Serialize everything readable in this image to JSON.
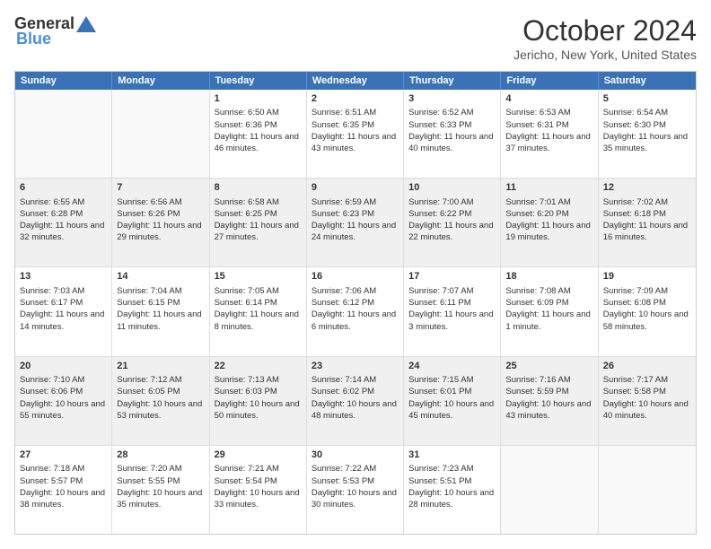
{
  "header": {
    "logo_general": "General",
    "logo_blue": "Blue",
    "month_title": "October 2024",
    "location": "Jericho, New York, United States"
  },
  "weekdays": [
    "Sunday",
    "Monday",
    "Tuesday",
    "Wednesday",
    "Thursday",
    "Friday",
    "Saturday"
  ],
  "rows": [
    [
      {
        "day": "",
        "sunrise": "",
        "sunset": "",
        "daylight": "",
        "empty": true
      },
      {
        "day": "",
        "sunrise": "",
        "sunset": "",
        "daylight": "",
        "empty": true
      },
      {
        "day": "1",
        "sunrise": "Sunrise: 6:50 AM",
        "sunset": "Sunset: 6:36 PM",
        "daylight": "Daylight: 11 hours and 46 minutes."
      },
      {
        "day": "2",
        "sunrise": "Sunrise: 6:51 AM",
        "sunset": "Sunset: 6:35 PM",
        "daylight": "Daylight: 11 hours and 43 minutes."
      },
      {
        "day": "3",
        "sunrise": "Sunrise: 6:52 AM",
        "sunset": "Sunset: 6:33 PM",
        "daylight": "Daylight: 11 hours and 40 minutes."
      },
      {
        "day": "4",
        "sunrise": "Sunrise: 6:53 AM",
        "sunset": "Sunset: 6:31 PM",
        "daylight": "Daylight: 11 hours and 37 minutes."
      },
      {
        "day": "5",
        "sunrise": "Sunrise: 6:54 AM",
        "sunset": "Sunset: 6:30 PM",
        "daylight": "Daylight: 11 hours and 35 minutes."
      }
    ],
    [
      {
        "day": "6",
        "sunrise": "Sunrise: 6:55 AM",
        "sunset": "Sunset: 6:28 PM",
        "daylight": "Daylight: 11 hours and 32 minutes."
      },
      {
        "day": "7",
        "sunrise": "Sunrise: 6:56 AM",
        "sunset": "Sunset: 6:26 PM",
        "daylight": "Daylight: 11 hours and 29 minutes."
      },
      {
        "day": "8",
        "sunrise": "Sunrise: 6:58 AM",
        "sunset": "Sunset: 6:25 PM",
        "daylight": "Daylight: 11 hours and 27 minutes."
      },
      {
        "day": "9",
        "sunrise": "Sunrise: 6:59 AM",
        "sunset": "Sunset: 6:23 PM",
        "daylight": "Daylight: 11 hours and 24 minutes."
      },
      {
        "day": "10",
        "sunrise": "Sunrise: 7:00 AM",
        "sunset": "Sunset: 6:22 PM",
        "daylight": "Daylight: 11 hours and 22 minutes."
      },
      {
        "day": "11",
        "sunrise": "Sunrise: 7:01 AM",
        "sunset": "Sunset: 6:20 PM",
        "daylight": "Daylight: 11 hours and 19 minutes."
      },
      {
        "day": "12",
        "sunrise": "Sunrise: 7:02 AM",
        "sunset": "Sunset: 6:18 PM",
        "daylight": "Daylight: 11 hours and 16 minutes."
      }
    ],
    [
      {
        "day": "13",
        "sunrise": "Sunrise: 7:03 AM",
        "sunset": "Sunset: 6:17 PM",
        "daylight": "Daylight: 11 hours and 14 minutes."
      },
      {
        "day": "14",
        "sunrise": "Sunrise: 7:04 AM",
        "sunset": "Sunset: 6:15 PM",
        "daylight": "Daylight: 11 hours and 11 minutes."
      },
      {
        "day": "15",
        "sunrise": "Sunrise: 7:05 AM",
        "sunset": "Sunset: 6:14 PM",
        "daylight": "Daylight: 11 hours and 8 minutes."
      },
      {
        "day": "16",
        "sunrise": "Sunrise: 7:06 AM",
        "sunset": "Sunset: 6:12 PM",
        "daylight": "Daylight: 11 hours and 6 minutes."
      },
      {
        "day": "17",
        "sunrise": "Sunrise: 7:07 AM",
        "sunset": "Sunset: 6:11 PM",
        "daylight": "Daylight: 11 hours and 3 minutes."
      },
      {
        "day": "18",
        "sunrise": "Sunrise: 7:08 AM",
        "sunset": "Sunset: 6:09 PM",
        "daylight": "Daylight: 11 hours and 1 minute."
      },
      {
        "day": "19",
        "sunrise": "Sunrise: 7:09 AM",
        "sunset": "Sunset: 6:08 PM",
        "daylight": "Daylight: 10 hours and 58 minutes."
      }
    ],
    [
      {
        "day": "20",
        "sunrise": "Sunrise: 7:10 AM",
        "sunset": "Sunset: 6:06 PM",
        "daylight": "Daylight: 10 hours and 55 minutes."
      },
      {
        "day": "21",
        "sunrise": "Sunrise: 7:12 AM",
        "sunset": "Sunset: 6:05 PM",
        "daylight": "Daylight: 10 hours and 53 minutes."
      },
      {
        "day": "22",
        "sunrise": "Sunrise: 7:13 AM",
        "sunset": "Sunset: 6:03 PM",
        "daylight": "Daylight: 10 hours and 50 minutes."
      },
      {
        "day": "23",
        "sunrise": "Sunrise: 7:14 AM",
        "sunset": "Sunset: 6:02 PM",
        "daylight": "Daylight: 10 hours and 48 minutes."
      },
      {
        "day": "24",
        "sunrise": "Sunrise: 7:15 AM",
        "sunset": "Sunset: 6:01 PM",
        "daylight": "Daylight: 10 hours and 45 minutes."
      },
      {
        "day": "25",
        "sunrise": "Sunrise: 7:16 AM",
        "sunset": "Sunset: 5:59 PM",
        "daylight": "Daylight: 10 hours and 43 minutes."
      },
      {
        "day": "26",
        "sunrise": "Sunrise: 7:17 AM",
        "sunset": "Sunset: 5:58 PM",
        "daylight": "Daylight: 10 hours and 40 minutes."
      }
    ],
    [
      {
        "day": "27",
        "sunrise": "Sunrise: 7:18 AM",
        "sunset": "Sunset: 5:57 PM",
        "daylight": "Daylight: 10 hours and 38 minutes."
      },
      {
        "day": "28",
        "sunrise": "Sunrise: 7:20 AM",
        "sunset": "Sunset: 5:55 PM",
        "daylight": "Daylight: 10 hours and 35 minutes."
      },
      {
        "day": "29",
        "sunrise": "Sunrise: 7:21 AM",
        "sunset": "Sunset: 5:54 PM",
        "daylight": "Daylight: 10 hours and 33 minutes."
      },
      {
        "day": "30",
        "sunrise": "Sunrise: 7:22 AM",
        "sunset": "Sunset: 5:53 PM",
        "daylight": "Daylight: 10 hours and 30 minutes."
      },
      {
        "day": "31",
        "sunrise": "Sunrise: 7:23 AM",
        "sunset": "Sunset: 5:51 PM",
        "daylight": "Daylight: 10 hours and 28 minutes."
      },
      {
        "day": "",
        "sunrise": "",
        "sunset": "",
        "daylight": "",
        "empty": true
      },
      {
        "day": "",
        "sunrise": "",
        "sunset": "",
        "daylight": "",
        "empty": true
      }
    ]
  ]
}
